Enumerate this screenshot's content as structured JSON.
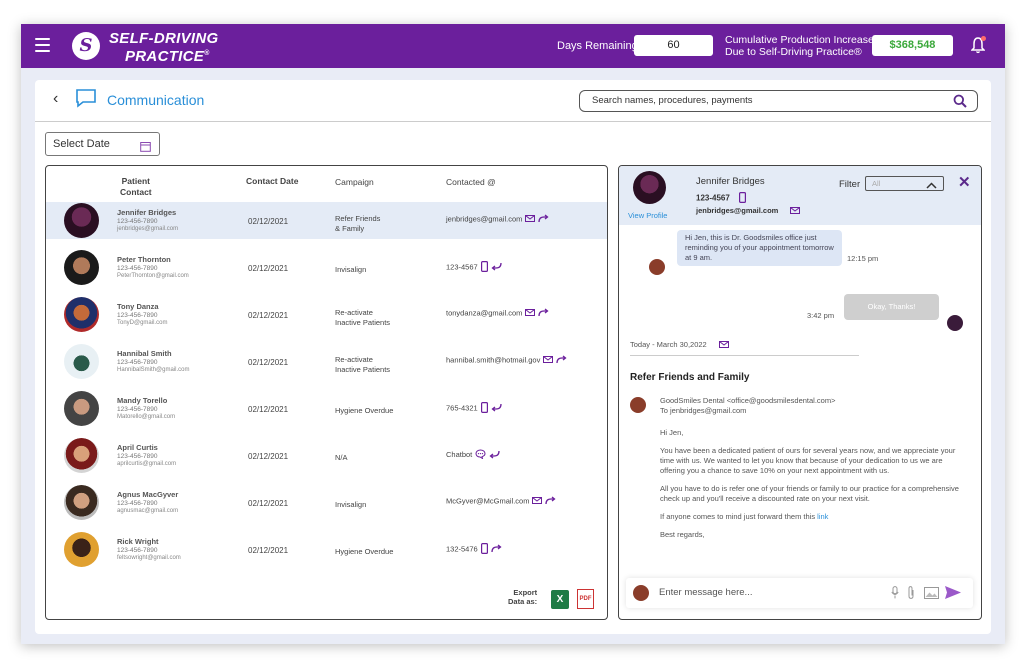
{
  "header": {
    "brand_line1": "SELF-DRIVING",
    "brand_line2": "PRACTICE",
    "brand_mark": "®",
    "days_label": "Days Remaining",
    "days_value": "60",
    "cumulative_label_1": "Cumulative Production Increase",
    "cumulative_label_2": "Due to Self-Driving Practice®",
    "cumulative_value": "$368,548",
    "accent": "#6b1f9c",
    "money_color": "#3aa83a"
  },
  "page": {
    "back": "‹",
    "title": "Communication",
    "search_placeholder": "Search names, procedures, payments",
    "date_select": "Select Date"
  },
  "table": {
    "headers": {
      "patient_1": "Patient",
      "patient_2": "Contact",
      "contact_date": "Contact Date",
      "campaign": "Campaign",
      "contacted": "Contacted @"
    },
    "rows": [
      {
        "name": "Jennifer Bridges",
        "phone": "123-456-7890",
        "email": "jenbridges@gmail.com",
        "date": "02/12/2021",
        "campaign_1": "Refer Friends",
        "campaign_2": "& Family",
        "contacted": "jenbridges@gmail.com",
        "method": "email",
        "direction": "out"
      },
      {
        "name": "Peter Thornton",
        "phone": "123-456-7890",
        "email": "PeterThornton@gmail.com",
        "date": "02/12/2021",
        "campaign_1": "Invisalign",
        "campaign_2": "",
        "contacted": "123-4567",
        "method": "phone",
        "direction": "in"
      },
      {
        "name": "Tony Danza",
        "phone": "123-456-7890",
        "email": "TonyD@gmail.com",
        "date": "02/12/2021",
        "campaign_1": "Re-activate",
        "campaign_2": "Inactive Patients",
        "contacted": "tonydanza@gmail.com",
        "method": "email",
        "direction": "out"
      },
      {
        "name": "Hannibal Smith",
        "phone": "123-456-7890",
        "email": "HannibalSmith@gmail.com",
        "date": "02/12/2021",
        "campaign_1": "Re-activate",
        "campaign_2": "Inactive Patients",
        "contacted": "hannibal.smith@hotmail.gov",
        "method": "email",
        "direction": "out"
      },
      {
        "name": "Mandy Torello",
        "phone": "123-456-7890",
        "email": "Matorello@gmail.com",
        "date": "02/12/2021",
        "campaign_1": "Hygiene Overdue",
        "campaign_2": "",
        "contacted": "765-4321",
        "method": "phone",
        "direction": "in"
      },
      {
        "name": "April Curtis",
        "phone": "123-456-7890",
        "email": "aprilcurtis@gmail.com",
        "date": "02/12/2021",
        "campaign_1": "N/A",
        "campaign_2": "",
        "contacted": "Chatbot",
        "method": "chat",
        "direction": "in"
      },
      {
        "name": "Agnus MacGyver",
        "phone": "123-456-7890",
        "email": "agnusmac@gmail.com",
        "date": "02/12/2021",
        "campaign_1": "Invisalign",
        "campaign_2": "",
        "contacted": "McGyver@McGmail.com",
        "method": "email",
        "direction": "out"
      },
      {
        "name": "Rick Wright",
        "phone": "123-456-7890",
        "email": "feltsowright@gmail.com",
        "date": "02/12/2021",
        "campaign_1": "Hygiene Overdue",
        "campaign_2": "",
        "contacted": "132-5476",
        "method": "phone",
        "direction": "out"
      }
    ],
    "export_1": "Export",
    "export_2": "Data as:",
    "xls": "X",
    "pdf": "PDF"
  },
  "chat": {
    "name": "Jennifer Bridges",
    "phone": "123-4567",
    "email": "jenbridges@gmail.com",
    "view_profile": "View Profile",
    "filter_label": "Filter",
    "filter_value": "All",
    "close": "✕",
    "incoming": "Hi Jen, this is Dr. Goodsmiles office just reminding you of your appointment tomorrow at 9 am.",
    "incoming_time": "12:15 pm",
    "outgoing": "Okay, Thanks!",
    "outgoing_time": "3:42 pm",
    "today": "Today - March 30,2022",
    "email_title": "Refer Friends and Family",
    "from": "GoodSmiles Dental  <office@goodsmilesdental.com>",
    "to": "To  jenbridges@gmail.com",
    "greeting": "Hi Jen,",
    "p1": "You have been a dedicated patient of ours for several years now, and we appreciate your time with us. We wanted to let you know that because of your dedication to us we are offering you a chance to save 10% on your next appointment with us.",
    "p2": "All you have to do is refer one of your friends or family to our practice for a comprehensive check up and you'll receive a discounted rate on your next visit.",
    "p3_text": "If anyone comes to mind just forward them this ",
    "p3_link": "link",
    "signoff": "Best regards,",
    "input_placeholder": "Enter message here..."
  }
}
